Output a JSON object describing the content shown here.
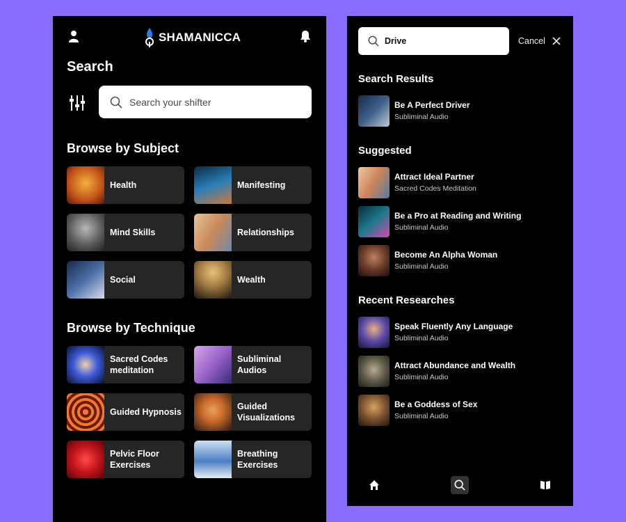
{
  "left": {
    "brand": "SHAMANICCA",
    "title": "Search",
    "search": {
      "placeholder": "Search your shifter"
    },
    "subjects_title": "Browse by Subject",
    "subjects": [
      {
        "label": "Health",
        "thumb_color": "#d66a1e"
      },
      {
        "label": "Manifesting",
        "thumb_color": "#2a7fb8"
      },
      {
        "label": "Mind Skills",
        "thumb_color": "#7b7b7b"
      },
      {
        "label": "Relationships",
        "thumb_color": "#c98a5a"
      },
      {
        "label": "Social",
        "thumb_color": "#4b6fa8"
      },
      {
        "label": "Wealth",
        "thumb_color": "#a07a40"
      }
    ],
    "techniques_title": "Browse by Technique",
    "techniques": [
      {
        "label_line1": "Sacred Codes",
        "label_line2": "meditation",
        "thumb_color": "#3e5bd8"
      },
      {
        "label_line1": "Subliminal",
        "label_line2": "Audios",
        "thumb_color": "#9a63c9"
      },
      {
        "label_line1": "Guided Hypnosis",
        "label_line2": "",
        "thumb_color": "#d6521f"
      },
      {
        "label_line1": "Guided",
        "label_line2": "Visualizations",
        "thumb_color": "#c96a2a"
      },
      {
        "label_line1": "Pelvic Floor",
        "label_line2": "Exercises",
        "thumb_color": "#c3141c"
      },
      {
        "label_line1": "Breathing",
        "label_line2": "Exercises",
        "thumb_color": "#4a7fc4"
      }
    ]
  },
  "right": {
    "search": {
      "value": "Drive"
    },
    "cancel_label": "Cancel",
    "results_title": "Search Results",
    "results": [
      {
        "title": "Be A Perfect Driver",
        "subtitle": "Subliminal Audio",
        "thumb_color": "#3f5f8a"
      }
    ],
    "suggested_title": "Suggested",
    "suggested": [
      {
        "title": "Attract Ideal Partner",
        "subtitle": "Sacred Codes Meditation",
        "thumb_color": "#c9845a"
      },
      {
        "title": "Be a Pro at Reading and Writing",
        "subtitle": "Subliminal Audio",
        "thumb_color": "#1f7a8c"
      },
      {
        "title": "Become An Alpha Woman",
        "subtitle": "Subliminal Audio",
        "thumb_color": "#6a3b2a"
      }
    ],
    "recent_title": "Recent Researches",
    "recent": [
      {
        "title": "Speak Fluently Any Language",
        "subtitle": "Subliminal Audio",
        "thumb_color": "#5a48a8"
      },
      {
        "title": "Attract Abundance and Wealth",
        "subtitle": "Subliminal Audio",
        "thumb_color": "#5e5a4a"
      },
      {
        "title": "Be a Goddess of Sex",
        "subtitle": "Subliminal Audio",
        "thumb_color": "#7a5230"
      }
    ],
    "nav": [
      {
        "icon": "home-icon"
      },
      {
        "icon": "search-icon",
        "active": true
      },
      {
        "icon": "book-icon"
      }
    ]
  }
}
